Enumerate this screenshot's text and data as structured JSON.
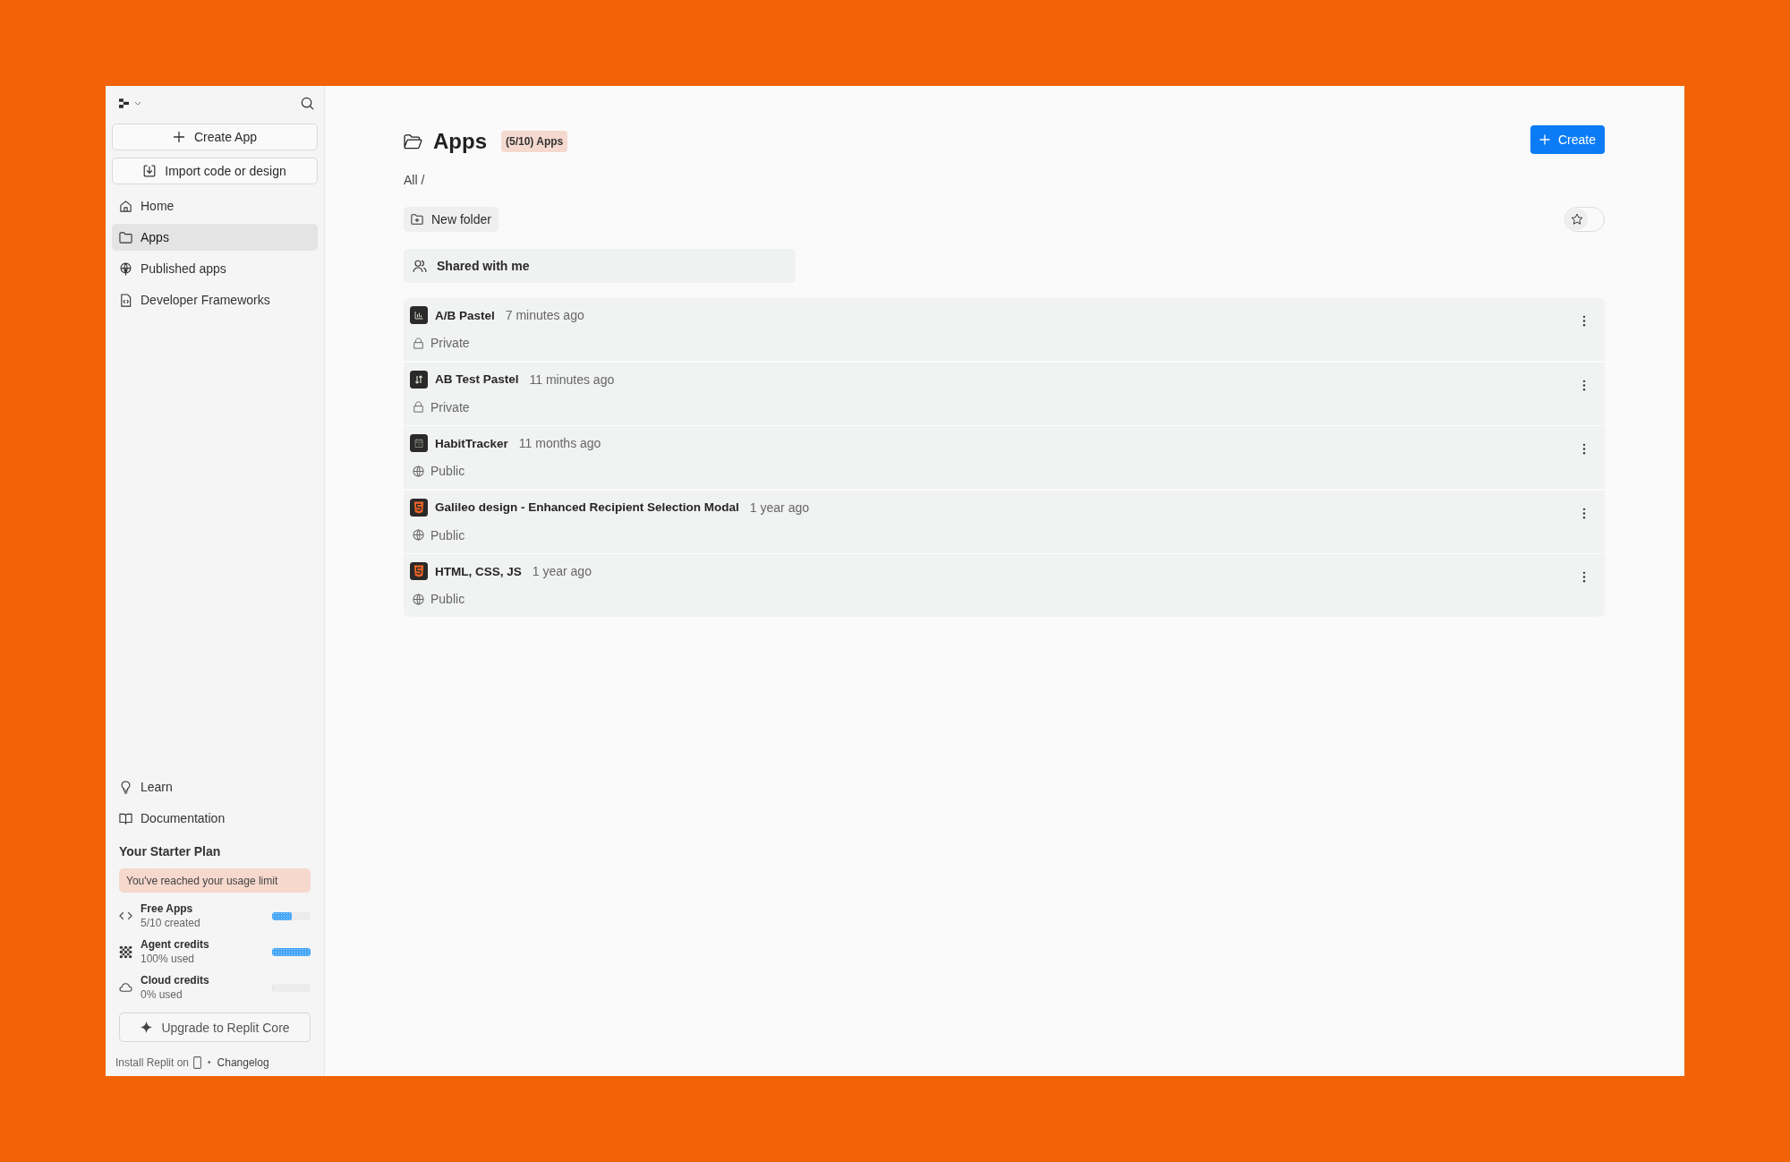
{
  "sidebar": {
    "actions": [
      {
        "kind": "create",
        "label": "Create App"
      },
      {
        "kind": "import",
        "label": "Import code or design"
      }
    ],
    "nav": [
      {
        "kind": "home",
        "label": "Home",
        "selected": false
      },
      {
        "kind": "folder",
        "label": "Apps",
        "selected": true
      },
      {
        "kind": "globe",
        "label": "Published apps",
        "selected": false
      },
      {
        "kind": "file",
        "label": "Developer Frameworks",
        "selected": false
      }
    ],
    "bottom_nav": [
      {
        "kind": "bulb",
        "label": "Learn",
        "selected": false
      },
      {
        "kind": "book",
        "label": "Documentation",
        "selected": false
      }
    ],
    "plan": {
      "title": "Your Starter Plan",
      "alert": "You've reached your usage limit",
      "meters": [
        {
          "kind": "code",
          "name": "Free Apps",
          "reading": "5/10 created",
          "level": 0.5
        },
        {
          "kind": "agent",
          "name": "Agent credits",
          "reading": "100% used",
          "level": 1
        },
        {
          "kind": "cloud",
          "name": "Cloud credits",
          "reading": "0% used",
          "level": 0
        }
      ]
    },
    "upgrade_button": "Upgrade to Replit Core",
    "footer": {
      "install_text": "Install Replit on",
      "separator": "•",
      "link": "Changelog"
    }
  },
  "main": {
    "title": "Apps",
    "badge": "(5/10) Apps",
    "create_button": "Create",
    "breadcrumb": "All /",
    "new_folder_button": "New folder",
    "favorites_toggle": {
      "on": false
    },
    "shared_folder": "Shared with me",
    "apps": [
      {
        "kind": "chart",
        "name": "A/B Pastel",
        "updated": "7 minutes ago",
        "visibility": {
          "kind": "private",
          "label": "Private"
        }
      },
      {
        "kind": "arrows",
        "name": "AB Test Pastel",
        "updated": "11 minutes ago",
        "visibility": {
          "kind": "private",
          "label": "Private"
        }
      },
      {
        "kind": "calendar",
        "name": "HabitTracker",
        "updated": "11 months ago",
        "visibility": {
          "kind": "public",
          "label": "Public"
        }
      },
      {
        "kind": "html",
        "name": "Galileo design - Enhanced Recipient Selection Modal",
        "updated": "1 year ago",
        "visibility": {
          "kind": "public",
          "label": "Public"
        }
      },
      {
        "kind": "html",
        "name": "HTML, CSS, JS",
        "updated": "1 year ago",
        "visibility": {
          "kind": "public",
          "label": "Public"
        }
      }
    ]
  }
}
